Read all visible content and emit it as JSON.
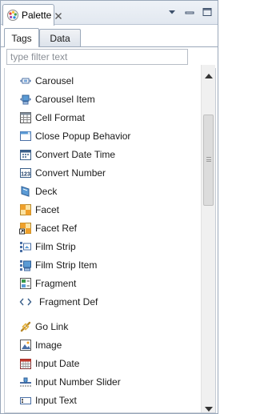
{
  "view": {
    "tab_label": "Palette"
  },
  "tabs": [
    {
      "label": "Tags",
      "active": true
    },
    {
      "label": "Data",
      "active": false
    }
  ],
  "filter": {
    "placeholder": "type filter text",
    "value": ""
  },
  "items": [
    {
      "label": "Carousel",
      "icon": "carousel-icon"
    },
    {
      "label": "Carousel Item",
      "icon": "carousel-item-icon"
    },
    {
      "label": "Cell Format",
      "icon": "cell-format-icon"
    },
    {
      "label": "Close Popup Behavior",
      "icon": "close-popup-behavior-icon"
    },
    {
      "label": "Convert Date Time",
      "icon": "convert-date-time-icon"
    },
    {
      "label": "Convert Number",
      "icon": "convert-number-icon"
    },
    {
      "label": "Deck",
      "icon": "deck-icon"
    },
    {
      "label": "Facet",
      "icon": "facet-icon"
    },
    {
      "label": "Facet Ref",
      "icon": "facet-ref-icon"
    },
    {
      "label": "Film Strip",
      "icon": "film-strip-icon"
    },
    {
      "label": "Film Strip Item",
      "icon": "film-strip-item-icon"
    },
    {
      "label": "Fragment",
      "icon": "fragment-icon"
    },
    {
      "label": "Fragment Def",
      "icon": "fragment-def-icon"
    },
    {
      "label": "Go Link",
      "icon": "go-link-icon"
    },
    {
      "label": "Image",
      "icon": "image-icon"
    },
    {
      "label": "Input Date",
      "icon": "input-date-icon"
    },
    {
      "label": "Input Number Slider",
      "icon": "input-number-slider-icon"
    },
    {
      "label": "Input Text",
      "icon": "input-text-icon"
    }
  ]
}
